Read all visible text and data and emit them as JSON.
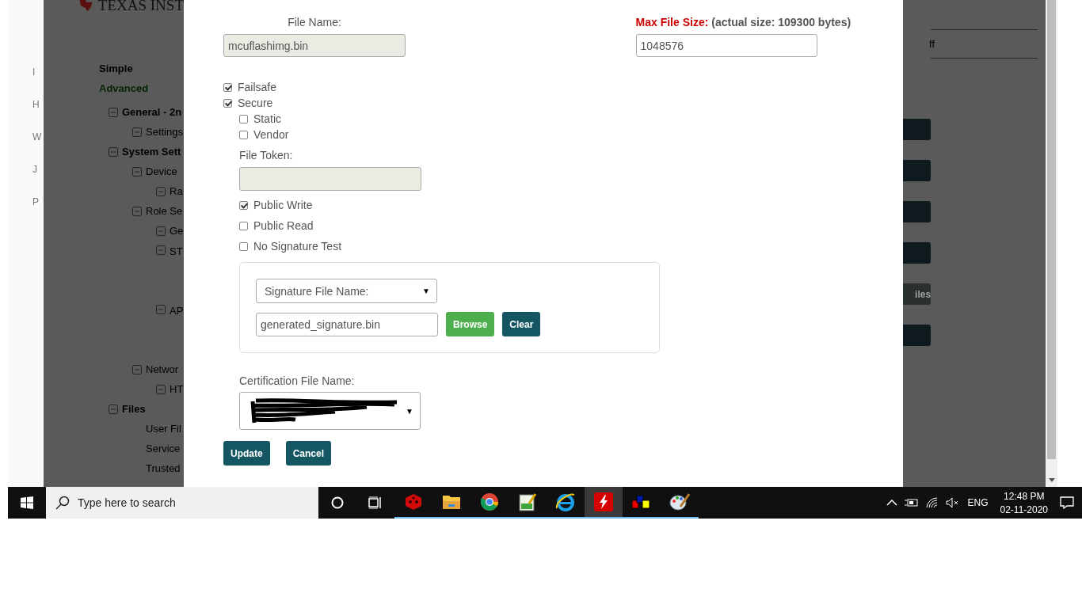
{
  "background_page": {
    "logo_text": "TEXAS INST",
    "side_letters": [
      "I",
      "H",
      "W",
      "J",
      "P"
    ],
    "modes": [
      {
        "label": "Simple",
        "selected": false
      },
      {
        "label": "Advanced",
        "selected": true
      }
    ],
    "tree": [
      {
        "label": "General - 2n",
        "collapsible": true,
        "children": [
          {
            "label": "Settings",
            "collapsible": true
          }
        ]
      },
      {
        "label": "System Sett",
        "collapsible": true,
        "children": [
          {
            "label": "Device",
            "collapsible": true,
            "children": [
              {
                "label": "Ra",
                "collapsible": true
              }
            ]
          },
          {
            "label": "Role Se",
            "collapsible": true,
            "children": [
              {
                "label": "Ge",
                "collapsible": true
              },
              {
                "label": "ST",
                "collapsible": true,
                "gap_after": true
              },
              {
                "label": "AP",
                "collapsible": true,
                "gap_after": true
              }
            ]
          },
          {
            "label": "Networ",
            "collapsible": true,
            "children": [
              {
                "label": "HT",
                "collapsible": true
              }
            ]
          }
        ]
      },
      {
        "label": "Files",
        "collapsible": true,
        "children": [
          {
            "label": "User Fil",
            "collapsible": false
          },
          {
            "label": "Service",
            "collapsible": false
          },
          {
            "label": "Trusted",
            "collapsible": false
          }
        ]
      }
    ],
    "right_field_text": "ff",
    "right_buttons": [
      {
        "disabled": false
      },
      {
        "disabled": false
      },
      {
        "disabled": false
      },
      {
        "disabled": false
      },
      {
        "label": "iles",
        "disabled": true
      },
      {
        "disabled": false
      }
    ]
  },
  "dialog": {
    "file_name": {
      "label": "File Name:",
      "value": "mcuflashimg.bin",
      "disabled": true
    },
    "max_file_size": {
      "label": "Max File Size:",
      "note": "(actual size: 109300 bytes)",
      "value": "1048576"
    },
    "options": [
      {
        "label": "Failsafe",
        "checked": true
      },
      {
        "label": "Secure",
        "checked": true,
        "children": [
          {
            "label": "Static",
            "checked": false
          },
          {
            "label": "Vendor",
            "checked": false
          }
        ]
      }
    ],
    "file_token": {
      "label": "File Token:",
      "disabled": true
    },
    "token_options": [
      {
        "label": "Public Write",
        "checked": true
      },
      {
        "label": "Public Read",
        "checked": false
      },
      {
        "label": "No Signature Test",
        "checked": false
      }
    ],
    "signature": {
      "select": "Signature File Name:",
      "caret": "▼",
      "value": "generated_signature.bin",
      "buttons": [
        {
          "label": "Browse",
          "kind": "success"
        },
        {
          "label": "Clear",
          "kind": "primary"
        }
      ]
    },
    "certification": {
      "label": "Certification File Name:",
      "redacted": true,
      "caret": "▼"
    },
    "actions": [
      "Update",
      "Cancel"
    ]
  },
  "taskbar": {
    "search_placeholder": "Type here to search",
    "apps": [
      {
        "kind": "cube",
        "running": true,
        "active": false
      },
      {
        "kind": "folder",
        "running": true,
        "active": false
      },
      {
        "kind": "chrome",
        "running": true,
        "active": false
      },
      {
        "kind": "notepad",
        "running": true,
        "active": false
      },
      {
        "kind": "ie",
        "running": true,
        "active": false
      },
      {
        "kind": "flash",
        "running": true,
        "active": true
      },
      {
        "kind": "blocks",
        "running": true,
        "active": false
      },
      {
        "kind": "paint",
        "running": true,
        "active": false
      }
    ],
    "language": "ENG",
    "time": "12:48 PM",
    "date": "02-11-2020"
  }
}
